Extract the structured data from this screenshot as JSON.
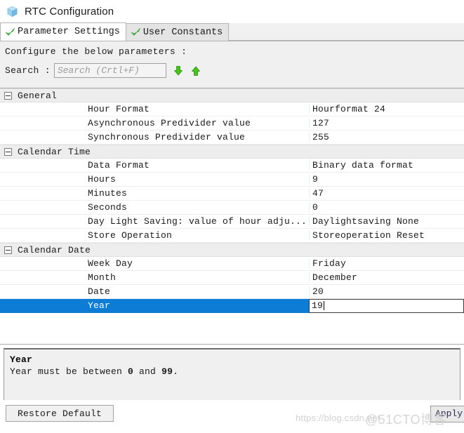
{
  "window": {
    "title": "RTC Configuration",
    "icon": "cube-icon"
  },
  "tabs": [
    {
      "label": "Parameter Settings",
      "icon": "check-icon",
      "active": true
    },
    {
      "label": "User Constants",
      "icon": "check-icon",
      "active": false
    }
  ],
  "header": {
    "configure_text": "Configure the below parameters :",
    "search_label": "Search :",
    "search_value": "",
    "search_placeholder": "Search (Crtl+F)",
    "find_next_icon": "arrow-down-icon",
    "find_prev_icon": "arrow-up-icon"
  },
  "grid": {
    "groups": [
      {
        "label": "General",
        "expanded": true,
        "rows": [
          {
            "name": "Hour Format",
            "value": "Hourformat 24",
            "selected": false
          },
          {
            "name": "Asynchronous Predivider value",
            "value": "127",
            "selected": false
          },
          {
            "name": "Synchronous Predivider value",
            "value": "255",
            "selected": false
          }
        ]
      },
      {
        "label": "Calendar Time",
        "expanded": true,
        "rows": [
          {
            "name": "Data Format",
            "value": "Binary data format",
            "selected": false
          },
          {
            "name": "Hours",
            "value": "9",
            "selected": false
          },
          {
            "name": "Minutes",
            "value": "47",
            "selected": false
          },
          {
            "name": "Seconds",
            "value": "0",
            "selected": false
          },
          {
            "name": "Day Light Saving: value of hour adju...",
            "value": "Daylightsaving None",
            "selected": false
          },
          {
            "name": "Store Operation",
            "value": "Storeoperation Reset",
            "selected": false
          }
        ]
      },
      {
        "label": "Calendar Date",
        "expanded": true,
        "rows": [
          {
            "name": "Week Day",
            "value": "Friday",
            "selected": false
          },
          {
            "name": "Month",
            "value": "December",
            "selected": false
          },
          {
            "name": "Date",
            "value": "20",
            "selected": false
          },
          {
            "name": "Year",
            "value": "19",
            "selected": true
          }
        ]
      }
    ]
  },
  "info": {
    "title": "Year",
    "description_prefix": "Year must be between ",
    "description_min": "0",
    "description_mid": " and ",
    "description_max": "99",
    "description_suffix": "."
  },
  "footer": {
    "restore_label": "Restore Default",
    "apply_label": "Apply"
  },
  "watermarks": {
    "csdn": "https://blog.csdn.net",
    "cto": "@51CTO博客"
  },
  "colors": {
    "selection_blue": "#0c7cd5",
    "panel_gray": "#f0f0f0",
    "group_header_gray": "#ededed",
    "check_green": "#3fb63f",
    "arrow_green": "#3cc010"
  }
}
